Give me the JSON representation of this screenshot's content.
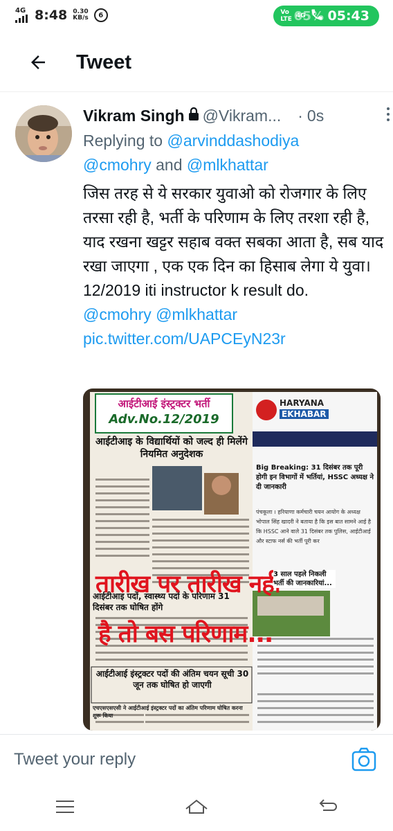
{
  "status_bar": {
    "time": "8:48",
    "network_left": "4G",
    "speed_value": "0.30",
    "speed_unit": "KB/s",
    "notif_count": "6",
    "vo_label": "Vo",
    "lte_label": "LTE",
    "net_right": "4G",
    "battery": "05%",
    "call_time": "05:43"
  },
  "header": {
    "title": "Tweet"
  },
  "tweet": {
    "author_name": "Vikram Singh",
    "handle": "@Vikram...",
    "separator": "·",
    "time": "0s",
    "replying_to_label": "Replying to",
    "reply_handle_1": "@arvinddashodiya",
    "reply_handle_2": "@cmohry",
    "reply_and": "and",
    "reply_handle_3": "@mlkhattar",
    "body_text": "जिस तरह से ये सरकार युवाओ को रोजगार के लिए तरसा रही है, भर्ती के परिणाम के लिए तरशा रही है, याद रखना खट्टर सहाब वक्त सबका आता है, सब याद रखा जाएगा , एक एक दिन का हिसाब लेगा ये युवा।",
    "body_line2": "12/2019 iti instructor k result do.",
    "mention_1": "@cmohry",
    "mention_2": "@mlkhattar",
    "pic_link": "pic.twitter.com/UAPCEyN23r"
  },
  "media": {
    "banner_title": "आईटीआई इंस्ट्रक्टर भर्ती",
    "banner_adv": "Adv.No.12/2019",
    "logo_top": "HARYANA",
    "logo_bottom": "EKHABAR",
    "headline_1": "आईटीआइ के विद्यार्थियों को जल्द ही मिलेंगे नियमित अनुदेशक",
    "right_headline": "Big Breaking: 31 दिसंबर तक पूरी होगी इन विभागों में भर्तियां, HSSC अध्यक्ष ने दी जानकारी",
    "right_body": "पंचकूला । हरियाणा कर्मचारी चयन आयोग के अध्यक्ष भोपाल सिंह खादरी ने बताया है कि इस बात सामने आई है कि HSSC आने वाले 31 दिसंबर तक पुलिस, आईटीआई और स्टाफ नर्स की भर्ती पूरी कर",
    "mid_headline": "आईटीआइ पदों, स्वास्थ्य पदों के परिणाम 31 दिसंबर तक घोषित होंगे",
    "overlay_1": "तारीख पर तारीख नहीं",
    "overlay_2": "है तो बस परिणाम...",
    "small_box": "3 साल पहले निकली भर्ती की जानकारियां...",
    "bottom_headline": "आईटीआई इंस्ट्रक्टर पदों की अंतिम चयन सूची 30 जून तक घोषित हो जाएगी",
    "bottom_sub": "एचएसएसएसी ने आईटीआई इंस्ट्रक्टर पदों का अंतिम परिणाम घोषित करना शुरू किया"
  },
  "reply_bar": {
    "placeholder": "Tweet your reply"
  },
  "colors": {
    "accent": "#1d9bf0",
    "muted": "#536471",
    "call_pill": "#22c55e"
  },
  "icons": [
    "back-arrow-icon",
    "lock-icon",
    "more-icon",
    "camera-icon",
    "menu-icon",
    "home-icon",
    "back-nav-icon"
  ]
}
